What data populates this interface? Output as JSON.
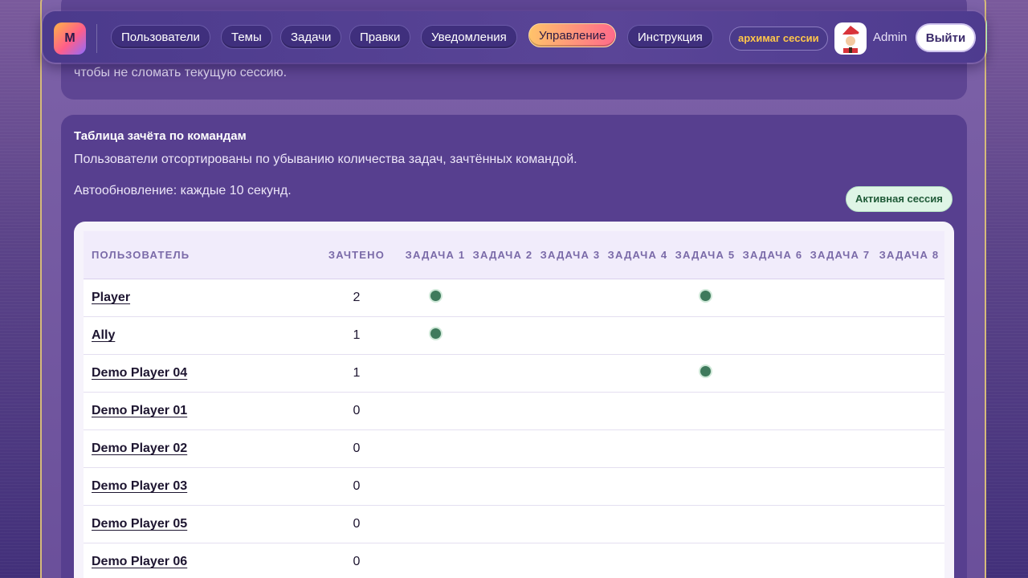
{
  "header": {
    "logo_letter": "M",
    "nav": [
      {
        "label": "Пользователи",
        "active": false
      },
      {
        "label": "Темы",
        "active": false
      },
      {
        "label": "Задачи",
        "active": false
      },
      {
        "label": "Правки",
        "active": false
      },
      {
        "label": "Уведомления",
        "active": false
      },
      {
        "label": "Управление",
        "active": true
      },
      {
        "label": "Инструкция",
        "active": false
      }
    ],
    "archive_badge": "архимаг сессии",
    "avatar_icon": "santa-avatar",
    "username": "Admin",
    "logout_label": "Выйти"
  },
  "previous_card": {
    "tail_text": "чтобы не сломать текущую сессию."
  },
  "scoreboard": {
    "title": "Таблица зачёта по командам",
    "description": "Пользователи отсортированы по убыванию количества задач, зачтённых командой.",
    "autorefresh": "Автообновление: каждые 10 секунд.",
    "session_badge": "Активная сессия",
    "columns": {
      "user": "Пользователь",
      "solved": "Зачтено",
      "tasks": [
        "Задача 1",
        "Задача 2",
        "Задача 3",
        "Задача 4",
        "Задача 5",
        "Задача 6",
        "Задача 7",
        "Задача 8"
      ]
    },
    "rows": [
      {
        "name": "Player",
        "solved": "2",
        "tasks": [
          true,
          false,
          false,
          false,
          true,
          false,
          false,
          false
        ]
      },
      {
        "name": "Ally",
        "solved": "1",
        "tasks": [
          true,
          false,
          false,
          false,
          false,
          false,
          false,
          false
        ]
      },
      {
        "name": "Demo Player 04",
        "solved": "1",
        "tasks": [
          false,
          false,
          false,
          false,
          true,
          false,
          false,
          false
        ]
      },
      {
        "name": "Demo Player 01",
        "solved": "0",
        "tasks": [
          false,
          false,
          false,
          false,
          false,
          false,
          false,
          false
        ]
      },
      {
        "name": "Demo Player 02",
        "solved": "0",
        "tasks": [
          false,
          false,
          false,
          false,
          false,
          false,
          false,
          false
        ]
      },
      {
        "name": "Demo Player 03",
        "solved": "0",
        "tasks": [
          false,
          false,
          false,
          false,
          false,
          false,
          false,
          false
        ]
      },
      {
        "name": "Demo Player 05",
        "solved": "0",
        "tasks": [
          false,
          false,
          false,
          false,
          false,
          false,
          false,
          false
        ]
      },
      {
        "name": "Demo Player 06",
        "solved": "0",
        "tasks": [
          false,
          false,
          false,
          false,
          false,
          false,
          false,
          false
        ]
      }
    ]
  },
  "colors": {
    "accent_gradient_start": "#ffc36a",
    "accent_gradient_end": "#ff6a8a",
    "solved_dot": "#3f7a5c",
    "session_badge_bg": "#dff5e6"
  }
}
